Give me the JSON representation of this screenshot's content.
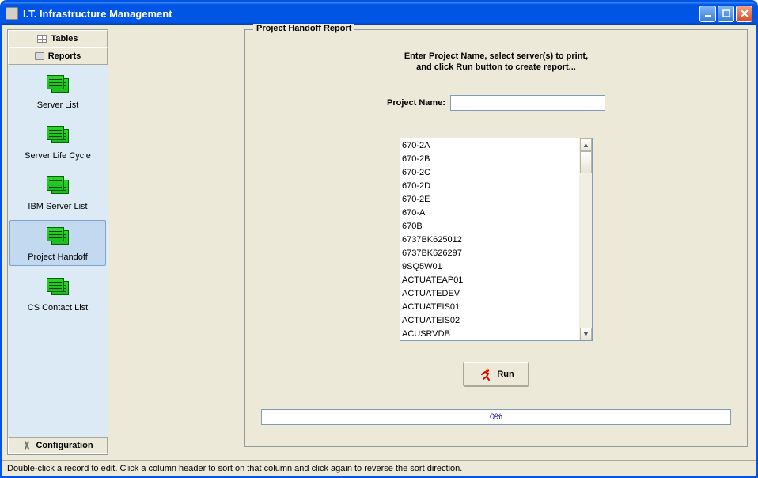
{
  "window": {
    "title": "I.T. Infrastructure Management"
  },
  "sidebar": {
    "tables_label": "Tables",
    "reports_label": "Reports",
    "config_label": "Configuration",
    "items": [
      {
        "label": "Server List"
      },
      {
        "label": "Server Life Cycle"
      },
      {
        "label": "IBM Server List"
      },
      {
        "label": "Project Handoff"
      },
      {
        "label": "CS Contact List"
      }
    ],
    "selected_index": 3
  },
  "report": {
    "legend": "Project Handoff Report",
    "instructions_l1": "Enter Project Name, select server(s) to print,",
    "instructions_l2": "and click Run button to create report...",
    "project_name_label": "Project Name:",
    "project_name_value": "",
    "servers": [
      "670-2A",
      "670-2B",
      "670-2C",
      "670-2D",
      "670-2E",
      "670-A",
      "670B",
      "6737BK625012",
      "6737BK626297",
      "9SQ5W01",
      "ACTUATEAP01",
      "ACTUATEDEV",
      "ACTUATEIS01",
      "ACTUATEIS02",
      "ACUSRVDB"
    ],
    "run_label": "Run",
    "progress_text": "0%"
  },
  "statusbar": {
    "hint": "Double-click a record to edit.  Click a column header to sort on that column and click again to reverse the sort direction."
  }
}
